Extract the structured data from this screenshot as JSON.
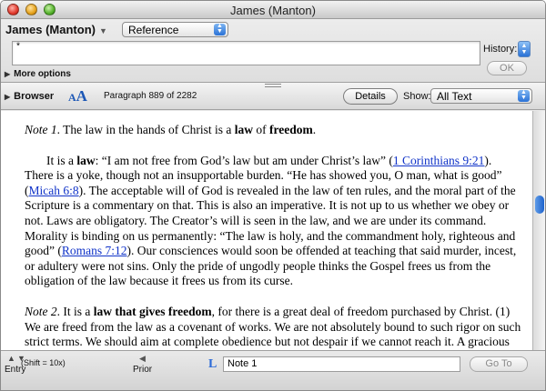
{
  "window": {
    "title": "James (Manton)"
  },
  "search": {
    "target": "James (Manton)",
    "type": "Reference",
    "query": "*",
    "history_label": "History:",
    "ok_label": "OK",
    "more_options_label": "More options"
  },
  "browser": {
    "label": "Browser",
    "font_size_glyph_small": "A",
    "font_size_glyph_large": "A",
    "paragraph_info": "Paragraph 889  of 2282",
    "details_label": "Details",
    "show_label": "Show:",
    "show_value": "All Text"
  },
  "text": {
    "p1": {
      "italic": "Note 1",
      "t1": ". The law in the hands of Christ is a ",
      "b1": "law",
      "t2": " of ",
      "b2": "freedom",
      "t3": "."
    },
    "p2": {
      "t1": "It is a ",
      "b1": "law",
      "t2": ": “I am not free from God’s law but am under Christ’s law” (",
      "link1": "1 Corinthians 9:21",
      "t3": "). There is a yoke, though not an insupportable burden. “He has showed you, O man, what is good” (",
      "link2": "Micah 6:8",
      "t4": "). The acceptable will of God is revealed in the law of ten rules, and the moral part of the Scripture is a commentary on that. This is also an imperative. It is not up to us whether we obey or not. Laws are obligatory. The Creator’s will is seen in the law, and we are under its command. Morality is binding on us permanently: “The law is holy, and the commandment holy, righteous and good” (",
      "link3": "Romans 7:12",
      "t5": "). Our consciences would soon be offended at teaching that said murder, incest, or adultery were not sins. Only the pride of ungodly people thinks the Gospel frees us from the obligation of the law because it frees us from its curse."
    },
    "p3": {
      "italic": "Note 2",
      "t1": ". It is a ",
      "b1": "law that gives freedom",
      "t2": ", for there is a great deal of freedom purchased by Christ. (1) We are freed from the law as a covenant of works. We are not absolutely bound to such rigor on such strict terms. We should aim at complete obedience but not despair if we cannot reach it. A gracious heart cannot offend a good God without sadness. Sin is still damning in its own nature, still a violation of a righteous law, still an affront to God. You have more reason to be"
    }
  },
  "bottom": {
    "entry_label": "Entry",
    "shift_label": "(Shift = 10x)",
    "prior_label": "Prior",
    "goto_value": "Note 1",
    "goto_label": "Go To"
  },
  "colors": {
    "link": "#1033c8",
    "accent_blue": "#2a72d6"
  }
}
